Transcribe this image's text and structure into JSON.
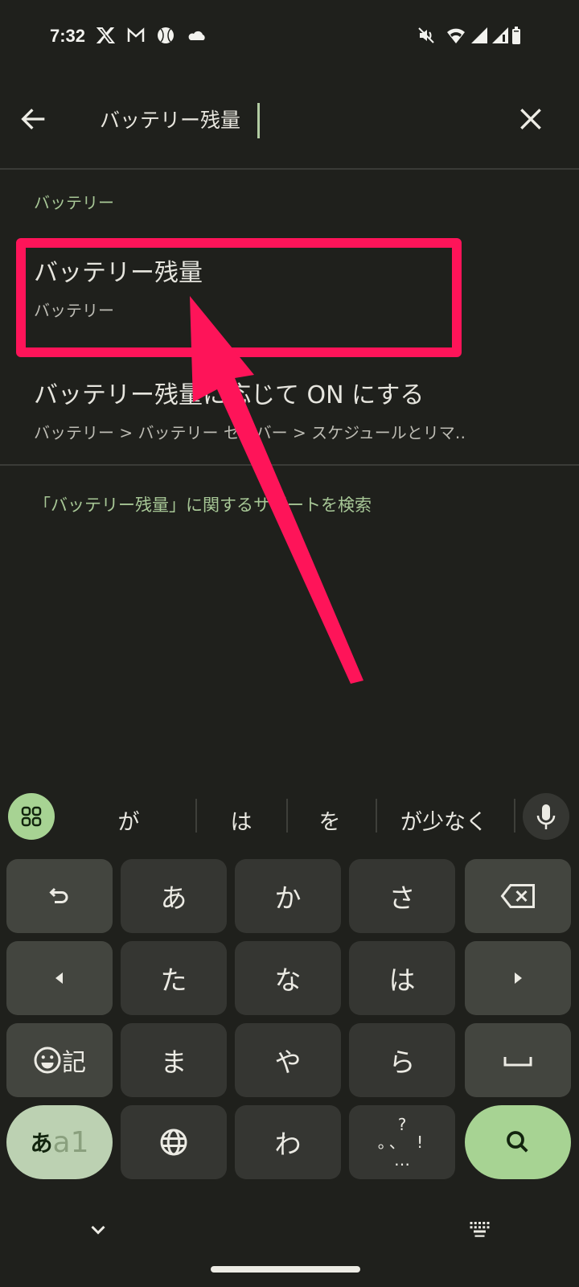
{
  "status_bar": {
    "time": "7:32",
    "left_icons": [
      "x-icon",
      "gmail-icon",
      "baseball-icon",
      "cloud-icon"
    ],
    "right_icons": [
      "mute-icon",
      "wifi-icon",
      "signal-icon",
      "signal-2-icon",
      "battery-icon"
    ]
  },
  "search": {
    "query": "バッテリー残量",
    "back_icon": "arrow-left-icon",
    "clear_icon": "close-icon"
  },
  "results": {
    "section_header": "バッテリー",
    "items": [
      {
        "title": "バッテリー残量",
        "subtitle": "バッテリー"
      },
      {
        "title": "バッテリー残量に応じて ON にする",
        "subtitle": "バッテリー > バッテリー セーバー > スケジュールとリマ‥"
      }
    ],
    "support_link": "「バッテリー残量」に関するサポートを検索"
  },
  "annotation": {
    "color": "#fe1459",
    "highlighted_item": "バッテリー残量"
  },
  "keyboard": {
    "suggestions": [
      "が",
      "は",
      "を",
      "が少なく"
    ],
    "rows": [
      [
        "↶",
        "あ",
        "か",
        "さ",
        "⌫"
      ],
      [
        "◀",
        "た",
        "な",
        "は",
        "▶"
      ],
      [
        "☺記",
        "ま",
        "や",
        "ら",
        "␣"
      ],
      [
        "あa1",
        "🌐",
        "わ",
        "?。、!",
        "🔍"
      ]
    ],
    "emoji_label": "記",
    "lang_label_kana": "あ",
    "lang_label_alpha": "a1",
    "punct_top": "?",
    "punct_bottom": "…",
    "punct_exclaim": "!",
    "keys": {
      "a": "あ",
      "ka": "か",
      "sa": "さ",
      "ta": "た",
      "na": "な",
      "ha": "は",
      "ma": "ま",
      "ya": "や",
      "ra": "ら",
      "wa": "わ"
    },
    "accent_color": "#a7d393"
  }
}
